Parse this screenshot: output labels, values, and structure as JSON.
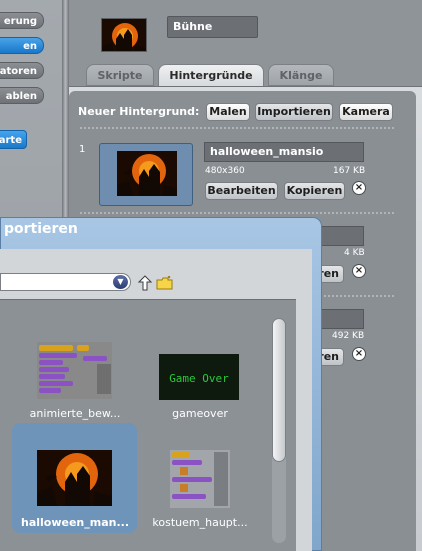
{
  "left_palette": {
    "categories": [
      "erung",
      "en",
      "atoren",
      "ablen"
    ],
    "blue_button": "arte"
  },
  "stage": {
    "name": "Bühne"
  },
  "tabs": [
    "Skripte",
    "Hintergründe",
    "Klänge"
  ],
  "costume_panel": {
    "new_background_label": "Neuer Hintergrund:",
    "buttons": [
      "Malen",
      "Importieren",
      "Kamera"
    ],
    "items": [
      {
        "number": "1",
        "name": "halloween_mansio",
        "dimensions": "480x360",
        "size": "167 KB",
        "edit_label": "Bearbeiten",
        "copy_label": "Kopieren"
      },
      {
        "size": "4 KB",
        "edit_label_fragment": "ren"
      },
      {
        "size": "492 KB",
        "edit_label_fragment": "ren"
      }
    ]
  },
  "import_dialog": {
    "title": "portieren",
    "files": [
      {
        "name": "animierte_bew..."
      },
      {
        "name": "gameover",
        "thumb_text": "Game Over"
      },
      {
        "name": "halloween_man...",
        "selected": true
      },
      {
        "name": "kostuem_haupt..."
      }
    ]
  },
  "colors": {
    "accent_blue": "#1a78c8",
    "selection": "#6f94ba",
    "dialog_title": "#80a6cc"
  }
}
